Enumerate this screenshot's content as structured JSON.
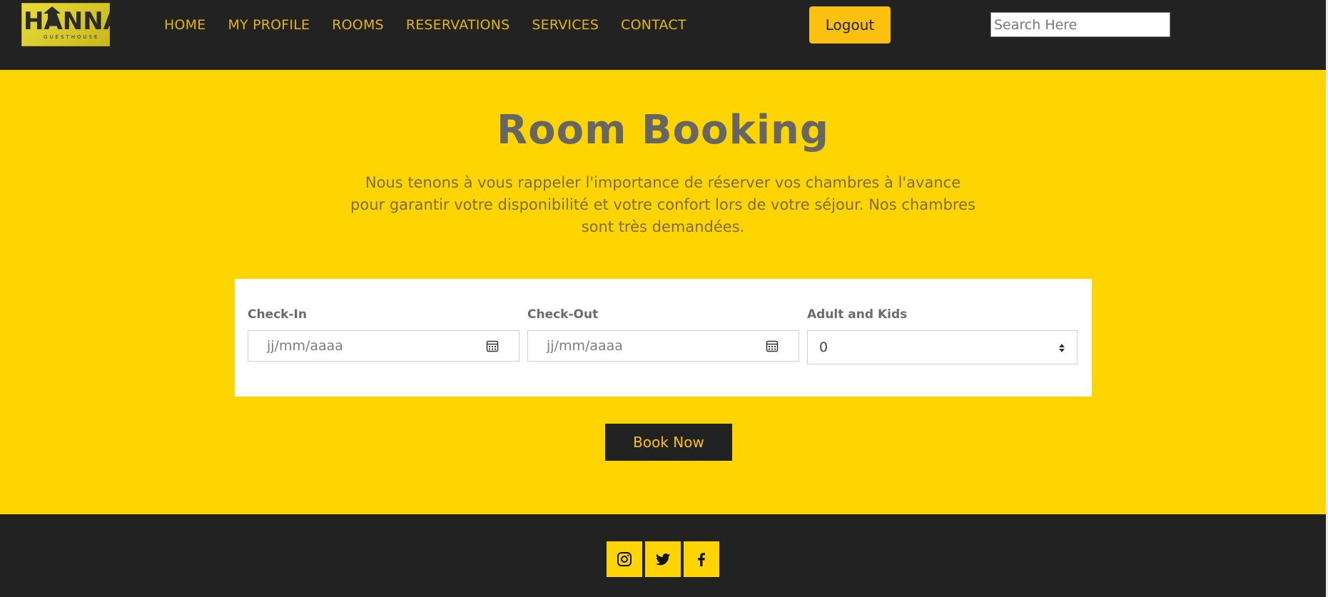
{
  "header": {
    "logo": {
      "text": "HANNA",
      "subtext": "GUESTHOUSE"
    },
    "nav": [
      {
        "label": "HOME"
      },
      {
        "label": "MY PROFILE"
      },
      {
        "label": "ROOMS"
      },
      {
        "label": "RESERVATIONS"
      },
      {
        "label": "SERVICES"
      },
      {
        "label": "CONTACT"
      }
    ],
    "logout_label": "Logout",
    "search": {
      "placeholder": "Search Here",
      "value": ""
    }
  },
  "main": {
    "title": "Room Booking",
    "subtitle": "Nous tenons à vous rappeler l'importance de réserver vos chambres à l'avance pour garantir votre disponibilité et votre confort lors de votre séjour. Nos chambres sont très demandées.",
    "form": {
      "check_in": {
        "label": "Check-In",
        "placeholder": "jj/mm/aaaa"
      },
      "check_out": {
        "label": "Check-Out",
        "placeholder": "jj/mm/aaaa"
      },
      "guests": {
        "label": "Adult and Kids",
        "value": "0"
      }
    },
    "book_label": "Book Now"
  },
  "footer": {
    "social": [
      {
        "icon": "instagram-icon"
      },
      {
        "icon": "twitter-icon"
      },
      {
        "icon": "facebook-icon"
      }
    ]
  },
  "colors": {
    "accent": "#fed500",
    "button_yellow": "#fcc10e",
    "dark": "#222222",
    "nav_text": "#e2b50f",
    "title_text": "#666666"
  }
}
